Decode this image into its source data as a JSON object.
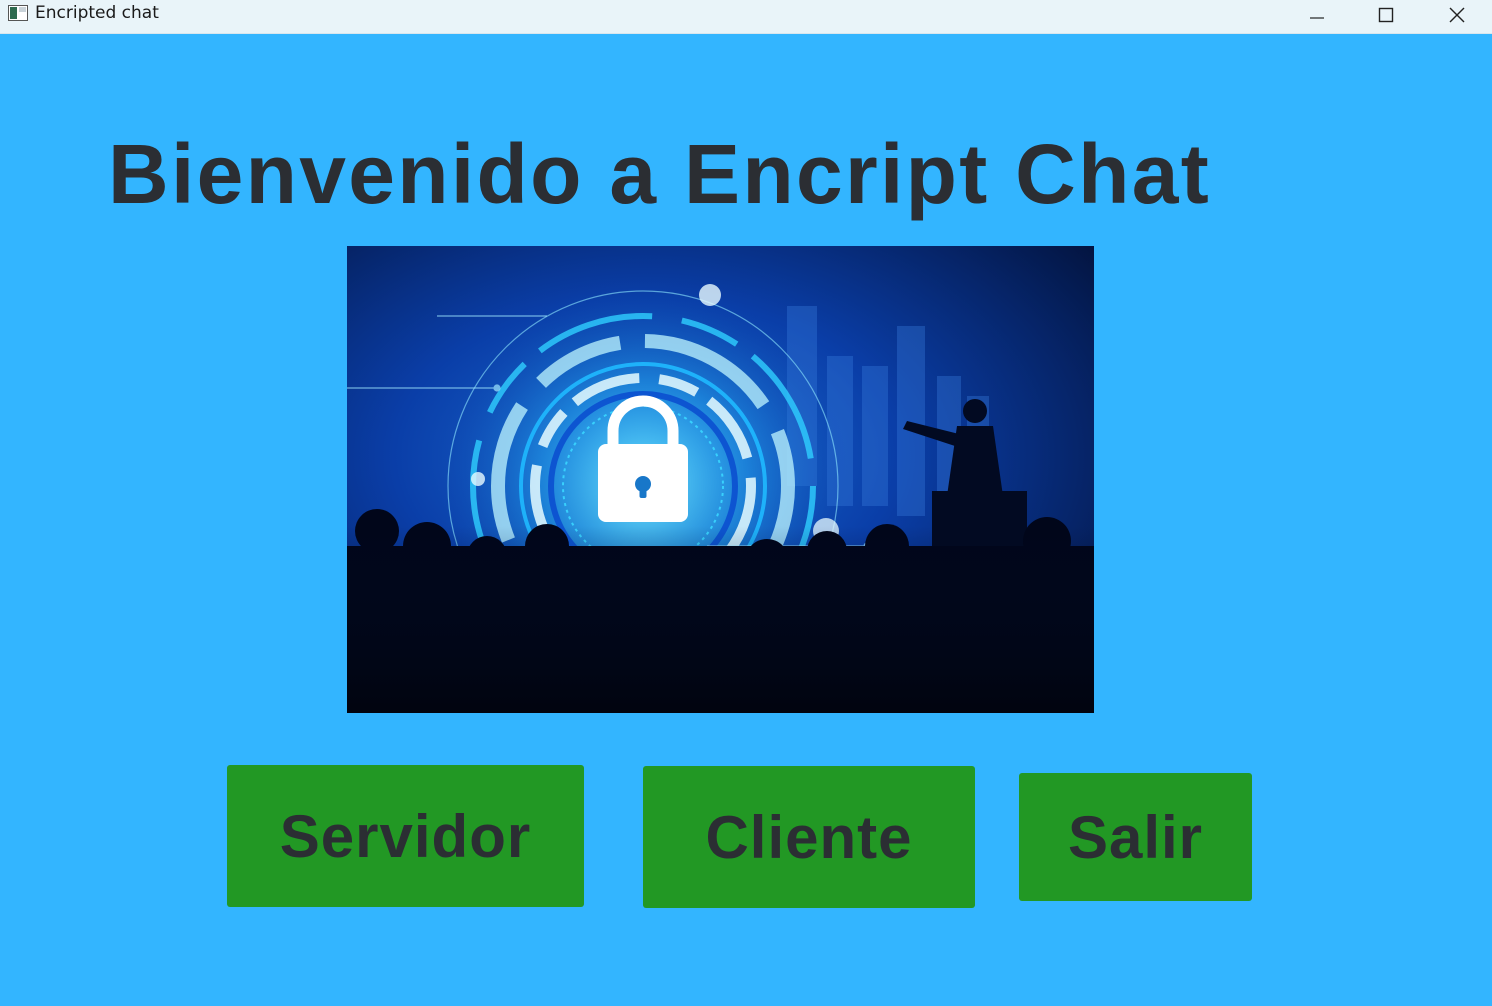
{
  "window": {
    "title": "Encripted chat",
    "icons": [
      "app-icon",
      "minimize-icon",
      "maximize-icon",
      "close-icon"
    ]
  },
  "main": {
    "heading": "Bienvenido a Encript Chat",
    "image_description_icon": "padlock-icon",
    "buttons": {
      "server_label": "Servidor",
      "client_label": "Cliente",
      "exit_label": "Salir"
    }
  },
  "colors": {
    "background": "#33b5ff",
    "button": "#229824",
    "text": "#2b2e33",
    "titlebar": "#e9f4f9"
  }
}
